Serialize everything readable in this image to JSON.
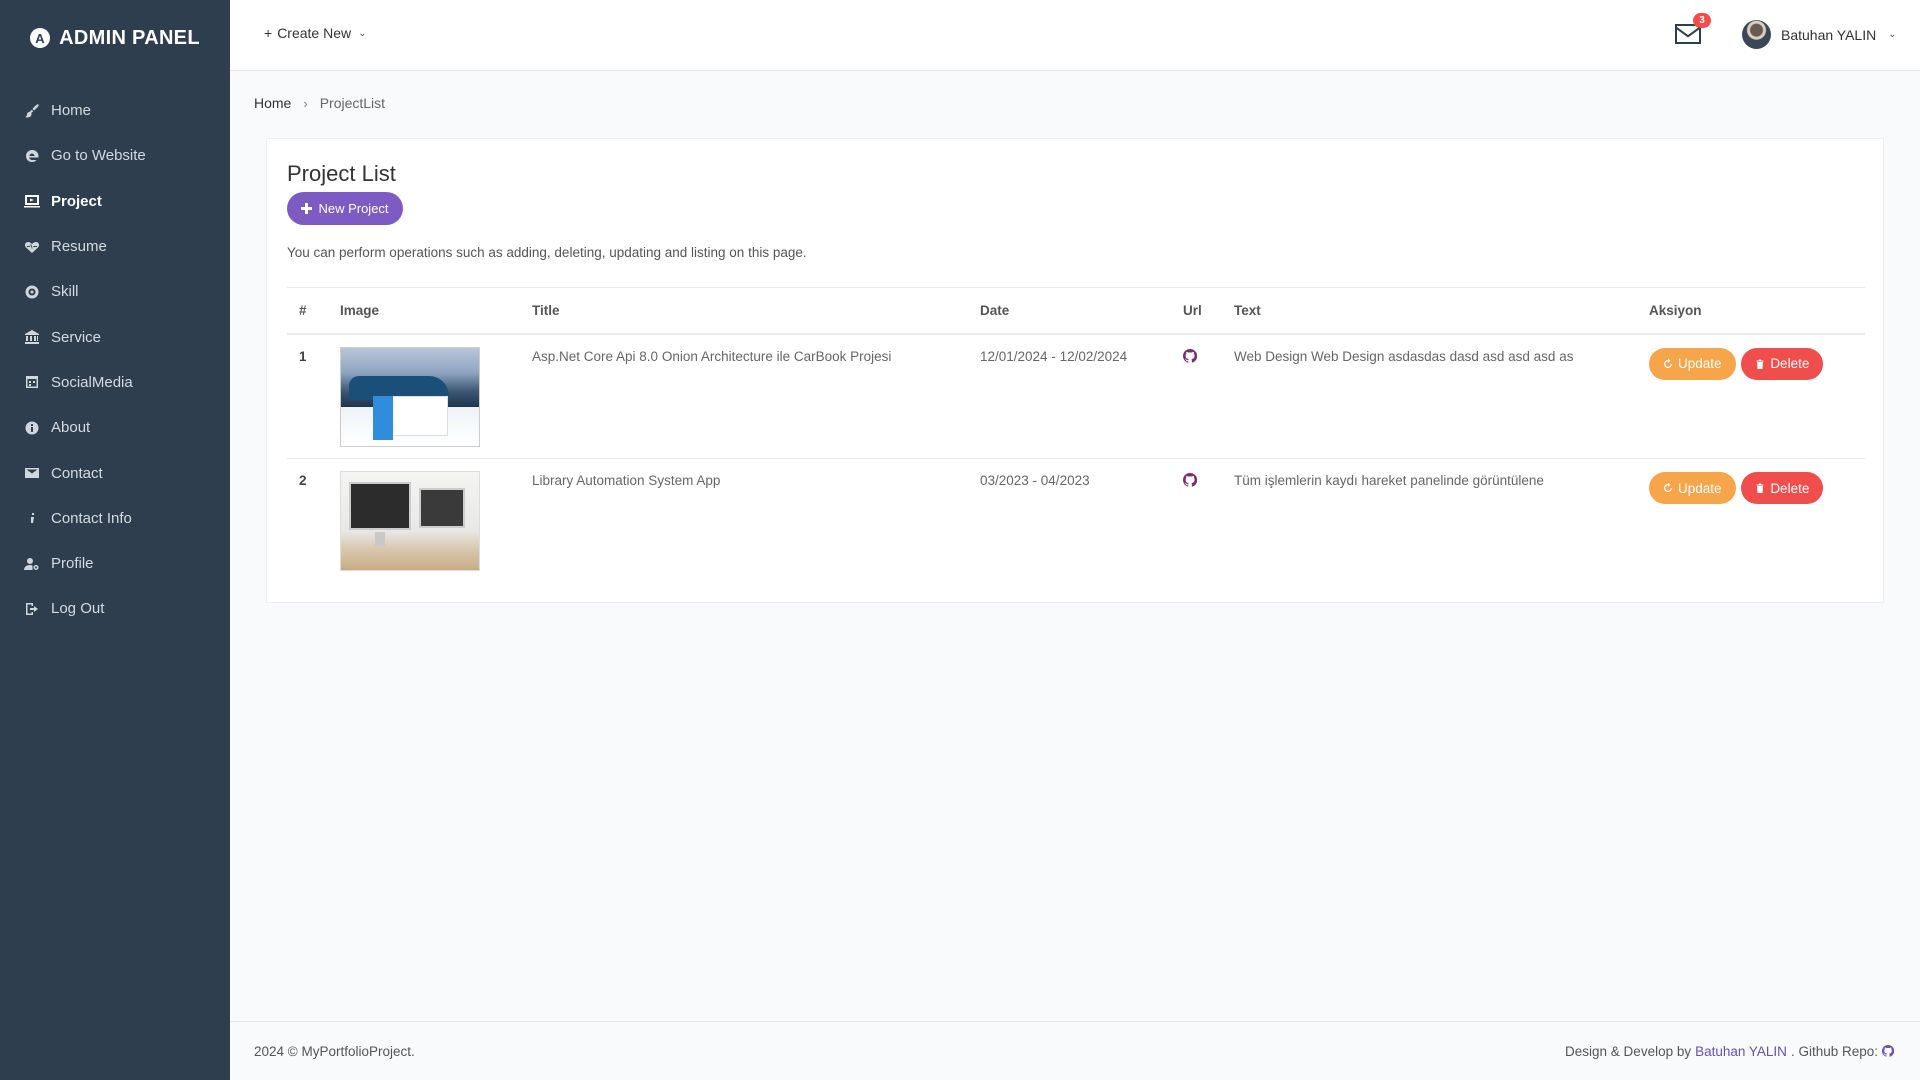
{
  "brand": {
    "title": "ADMIN PANEL",
    "logo_glyph": "A"
  },
  "sidebar": {
    "items": [
      {
        "label": "Home",
        "icon": "brush-icon"
      },
      {
        "label": "Go to Website",
        "icon": "edge-icon"
      },
      {
        "label": "Project",
        "icon": "laptop-icon",
        "active": true
      },
      {
        "label": "Resume",
        "icon": "heart-pulse-icon"
      },
      {
        "label": "Skill",
        "icon": "target-icon"
      },
      {
        "label": "Service",
        "icon": "bank-icon"
      },
      {
        "label": "SocialMedia",
        "icon": "calendar-icon"
      },
      {
        "label": "About",
        "icon": "info-circle-icon"
      },
      {
        "label": "Contact",
        "icon": "envelope-icon"
      },
      {
        "label": "Contact Info",
        "icon": "info-icon"
      },
      {
        "label": "Profile",
        "icon": "user-cog-icon"
      },
      {
        "label": "Log Out",
        "icon": "logout-icon"
      }
    ]
  },
  "topbar": {
    "create_new": "Create New",
    "mail_count": "3",
    "user_name": "Batuhan YALIN"
  },
  "breadcrumb": {
    "home": "Home",
    "current": "ProjectList"
  },
  "page": {
    "title": "Project List",
    "new_button": "New Project",
    "description": "You can perform operations such as adding, deleting, updating and listing on this page."
  },
  "table": {
    "headers": [
      "#",
      "Image",
      "Title",
      "Date",
      "Url",
      "Text",
      "Aksiyon"
    ],
    "rows": [
      {
        "num": "1",
        "title": "Asp.Net Core Api 8.0 Onion Architecture ile CarBook Projesi",
        "date": "12/01/2024 - 12/02/2024",
        "text": "Web Design Web Design asdasdas dasd asd asd asd as"
      },
      {
        "num": "2",
        "title": "Library Automation System App",
        "date": "03/2023 - 04/2023",
        "text": "Tüm işlemlerin kaydı hareket panelinde görüntülene"
      }
    ],
    "update_label": "Update",
    "delete_label": "Delete"
  },
  "footer": {
    "left": "2024 © MyPortfolioProject.",
    "right_prefix": "Design & Develop by",
    "author": "Batuhan YALIN",
    "repo_label": ". Github Repo:"
  },
  "colors": {
    "sidebar_bg": "#2e3e4e",
    "accent_purple": "#7c5cc4",
    "update_orange": "#f7a54a",
    "delete_red": "#f04d4d",
    "badge_red": "#f44b4b",
    "github_icon": "#7b2e6d"
  }
}
